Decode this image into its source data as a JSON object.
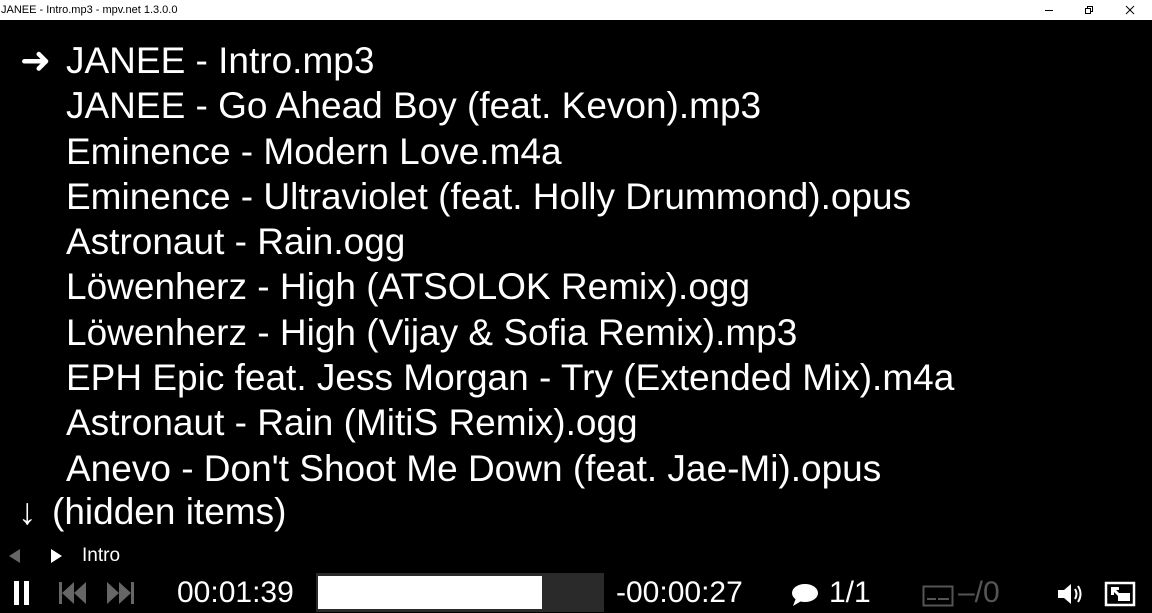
{
  "window": {
    "title": "JANEE - Intro.mp3 - mpv.net 1.3.0.0",
    "controls": [
      "minimize-icon",
      "restore-icon",
      "close-icon"
    ]
  },
  "playlist": {
    "current_marker": "➜",
    "items": [
      "JANEE - Intro.mp3",
      "JANEE - Go Ahead Boy (feat. Kevon).mp3",
      "Eminence - Modern Love.m4a",
      "Eminence - Ultraviolet (feat. Holly Drummond).opus",
      "Astronaut - Rain.ogg",
      "Löwenherz - High (ATSOLOK Remix).ogg",
      "Löwenherz - High (Vijay & Sofia Remix).mp3",
      "EPH Epic feat. Jess Morgan - Try (Extended Mix).m4a",
      "Astronaut - Rain (MitiS Remix).ogg",
      "Anevo - Don't Shoot Me Down (feat. Jae-Mi).opus"
    ],
    "hidden_arrow": "↓",
    "hidden_label": "(hidden items)"
  },
  "osc": {
    "chapter_title": "Intro",
    "elapsed": "00:01:39",
    "remaining": "-00:00:27",
    "progress": 0.79,
    "audio_track": "1/1",
    "subtitle_track": "–/0",
    "icons": {
      "play_pause": "pause-icon",
      "prev": "skip-back-icon",
      "next": "skip-forward-icon",
      "audio": "speech-bubble-icon",
      "subtitle": "subtitle-icon",
      "volume": "speaker-icon",
      "fullscreen": "fullscreen-icon"
    },
    "colors": {
      "active": "#ffffff",
      "inactive": "#666666",
      "seek_bg": "#2a2a2a"
    }
  }
}
